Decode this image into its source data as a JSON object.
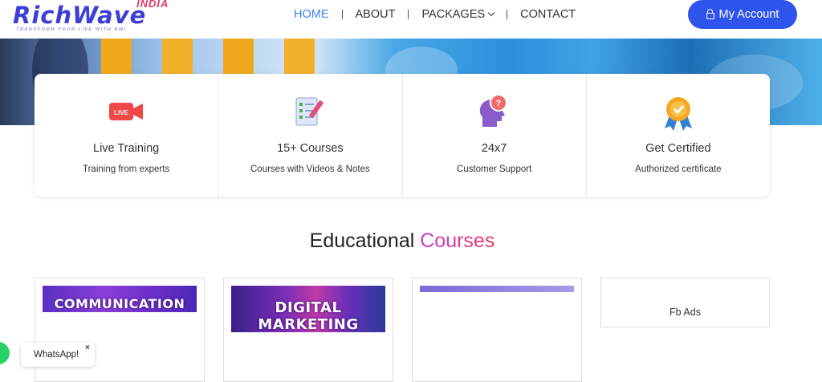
{
  "header": {
    "logo": {
      "text_main": "RichWave",
      "text_india": "INDIA",
      "tagline": "TRANSFORM YOUR LIFE WITH RWI"
    },
    "nav": [
      {
        "label": "HOME",
        "active": true
      },
      {
        "label": "ABOUT"
      },
      {
        "label": "PACKAGES",
        "has_dropdown": true
      },
      {
        "label": "CONTACT"
      }
    ],
    "account_button": {
      "label": "My Account",
      "icon": "lock-icon"
    }
  },
  "features": [
    {
      "title": "Live Training",
      "subtitle": "Training from experts",
      "icon": "live-video-icon"
    },
    {
      "title": "15+ Courses",
      "subtitle": "Courses with Videos & Notes",
      "icon": "course-notes-icon"
    },
    {
      "title": "24x7",
      "subtitle": "Customer Support",
      "icon": "support-question-icon"
    },
    {
      "title": "Get Certified",
      "subtitle": "Authorized certificate",
      "icon": "certificate-badge-icon"
    }
  ],
  "section": {
    "title_part1": "Educational",
    "title_part2": "Courses"
  },
  "courses": [
    {
      "thumb_text": "COMMUNICATION"
    },
    {
      "thumb_text": "DIGITAL MARKETING"
    },
    {
      "thumb_text": ""
    },
    {
      "label": "Fb Ads"
    }
  ],
  "whatsapp": {
    "label": "WhatsApp!",
    "close": "×"
  },
  "colors": {
    "accent": "#2f54eb",
    "nav_active": "#3b82f6",
    "live_red": "#f04747",
    "whatsapp_green": "#25d366"
  }
}
